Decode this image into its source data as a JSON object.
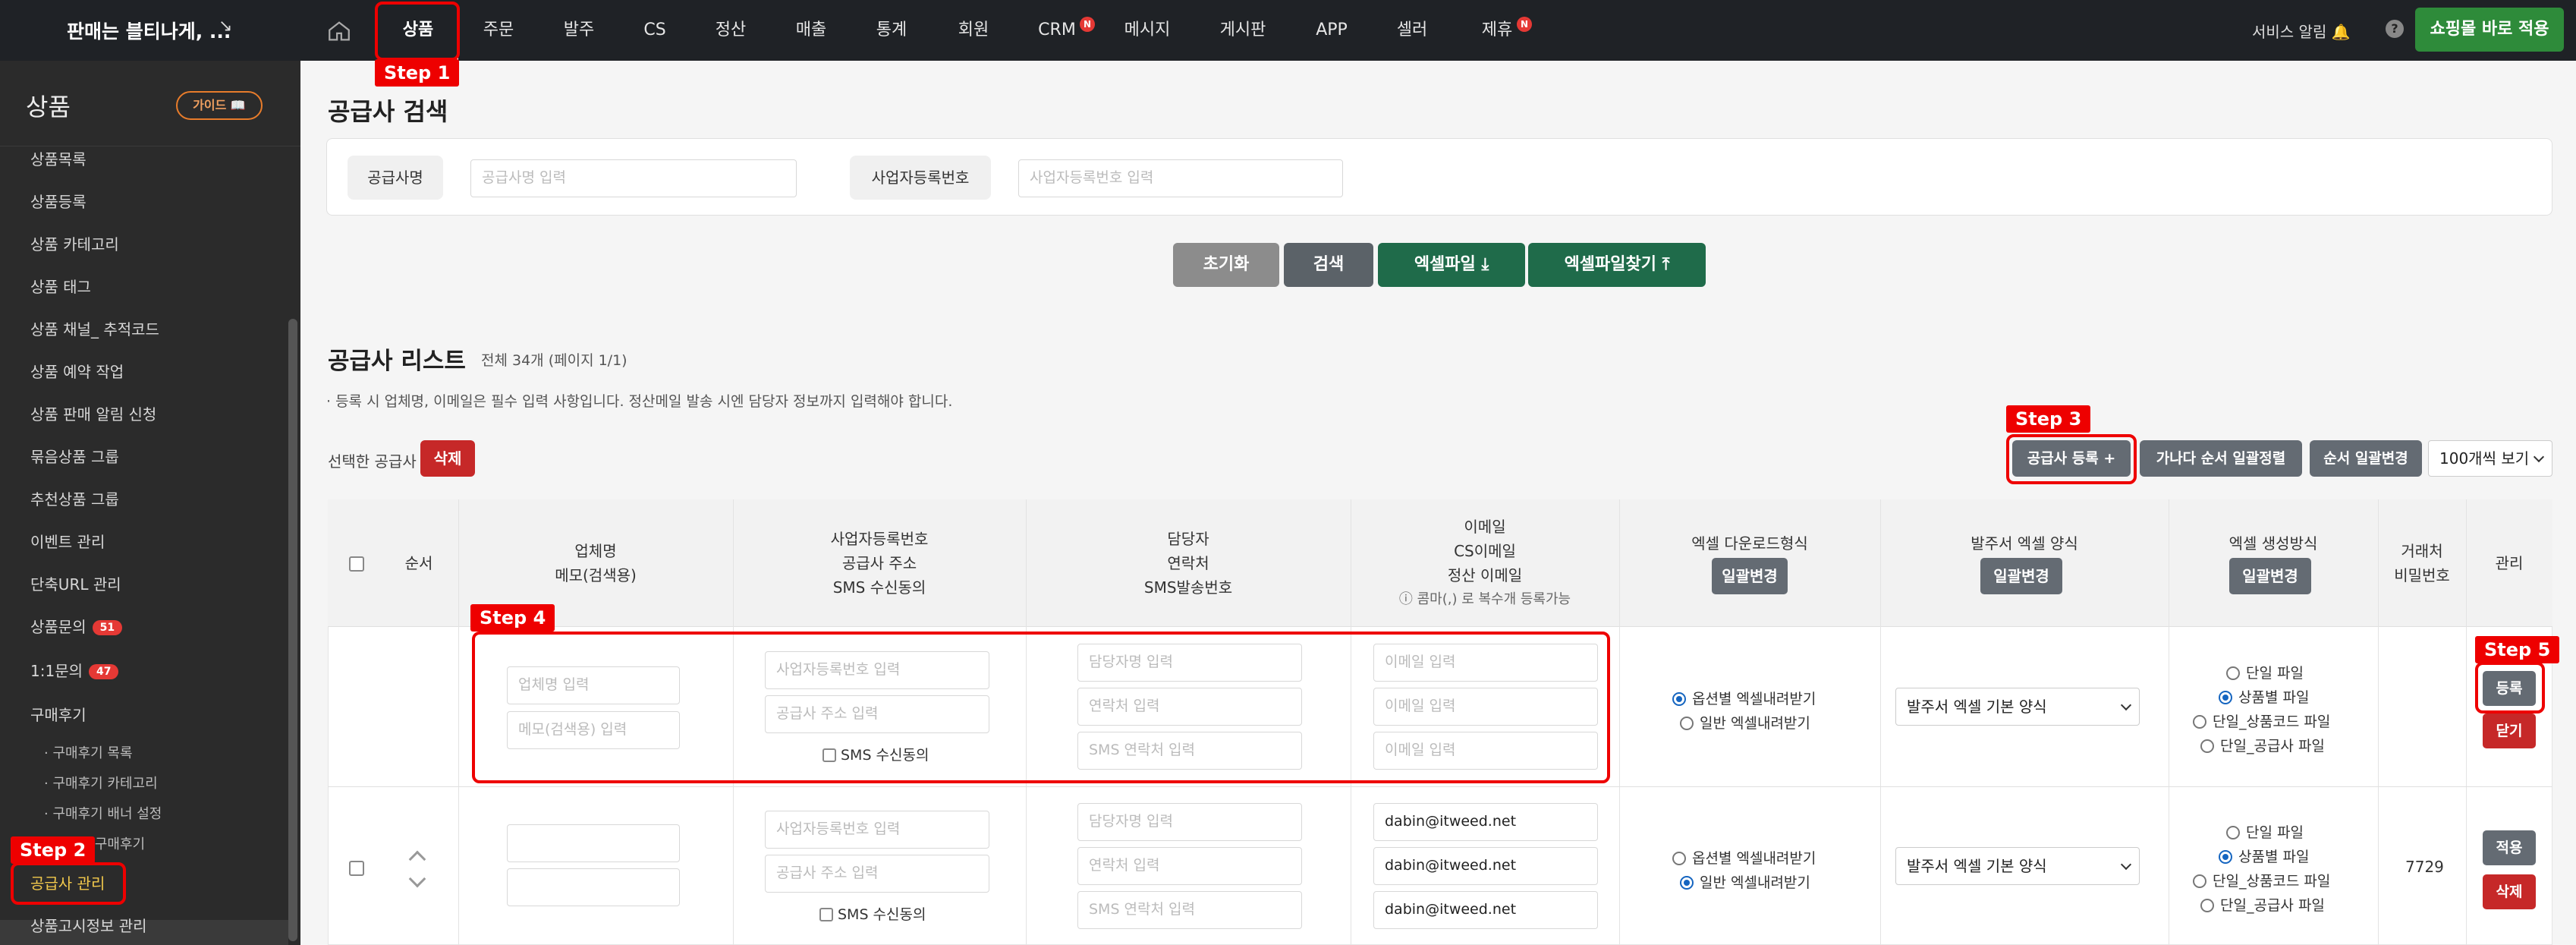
{
  "topbar": {
    "brand": "판매는 블티나게, ...",
    "nav": [
      "상품",
      "주문",
      "발주",
      "CS",
      "정산",
      "매출",
      "통계",
      "회원",
      "CRM",
      "메시지",
      "게시판",
      "APP",
      "셀러",
      "제휴"
    ],
    "nav_badge": "N",
    "service_alert": "서비스 알림",
    "help": "?",
    "shop_button": "쇼핑몰 바로 적용"
  },
  "sidebar": {
    "title": "상품",
    "guide": "가이드",
    "items": [
      "상품목록",
      "상품등록",
      "상품 카테고리",
      "상품 태그",
      "상품 채널_ 추적코드",
      "상품 예약 작업",
      "상품 판매 알림 신청",
      "묶음상품 그룹",
      "추천상품 그룹",
      "이벤트 관리",
      "단축URL 관리",
      "상품문의",
      "1:1문의",
      "구매후기"
    ],
    "inquiry_badge": "51",
    "qna_badge": "47",
    "sub_items": [
      "· 구매후기 목록",
      "· 구매후기 카테고리",
      "· 구매후기 배너 설정",
      "· 베스트 구매후기"
    ],
    "active_item": "공급사 관리",
    "last_item": "상품고시정보 관리"
  },
  "search": {
    "title": "공급사 검색",
    "name_label": "공급사명",
    "name_placeholder": "공급사명 입력",
    "biz_label": "사업자등록번호",
    "biz_placeholder": "사업자등록번호 입력",
    "reset": "초기화",
    "search": "검색",
    "excel": "엑셀파일",
    "excel_find": "엑셀파일찾기"
  },
  "list": {
    "title": "공급사 리스트",
    "meta": "전체 34개 (페이지 1/1)",
    "notice": "· 등록 시 업체명, 이메일은 필수 입력 사항입니다. 정산메일 발송 시엔 담당자 정보까지 입력해야 합니다.",
    "selected_label": "선택한 공급사",
    "delete": "삭제",
    "register": "공급사 등록 +",
    "sort_name": "가나다 순서 일괄정렬",
    "sort_change": "순서 일괄변경",
    "page_size": "100개씩 보기"
  },
  "table": {
    "headers": {
      "order": "순서",
      "company": [
        "업체명",
        "메모(검색용)"
      ],
      "biz": [
        "사업자등록번호",
        "공급사 주소",
        "SMS 수신동의"
      ],
      "contact": [
        "담당자",
        "연락처",
        "SMS발송번호"
      ],
      "email": [
        "이메일",
        "CS이메일",
        "정산 이메일"
      ],
      "email_note": "ⓘ 콤마(,) 로 복수개 등록가능",
      "excel_dl": "엑셀 다운로드형식",
      "order_excel": "발주서 엑셀 양식",
      "excel_gen": "엑셀 생성방식",
      "pw": [
        "거래처",
        "비밀번호"
      ],
      "manage": "관리",
      "bulk": "일괄변경"
    },
    "new_row": {
      "company_ph": "업체명 입력",
      "memo_ph": "메모(검색용) 입력",
      "biz_ph": "사업자등록번호 입력",
      "addr_ph": "공급사 주소 입력",
      "sms_agree": "SMS 수신동의",
      "manager_ph": "담당자명 입력",
      "phone_ph": "연락처 입력",
      "sms_ph": "SMS 연락처 입력",
      "email_ph": "이메일 입력",
      "dl_opt1": "옵션별 엑셀내려받기",
      "dl_opt2": "일반 엑셀내려받기",
      "order_form": "발주서 엑셀 기본 양식",
      "gen1": "단일 파일",
      "gen2": "상품별 파일",
      "gen3": "단일_상품코드 파일",
      "gen4": "단일_공급사 파일",
      "register": "등록",
      "close": "닫기"
    },
    "row1": {
      "email1": "dabin@itweed.net",
      "email2": "dabin@itweed.net",
      "email3": "dabin@itweed.net",
      "password": "7729",
      "apply": "적용",
      "delete": "삭제"
    }
  },
  "steps": [
    "Step 1",
    "Step 2",
    "Step 3",
    "Step 4",
    "Step 5"
  ]
}
